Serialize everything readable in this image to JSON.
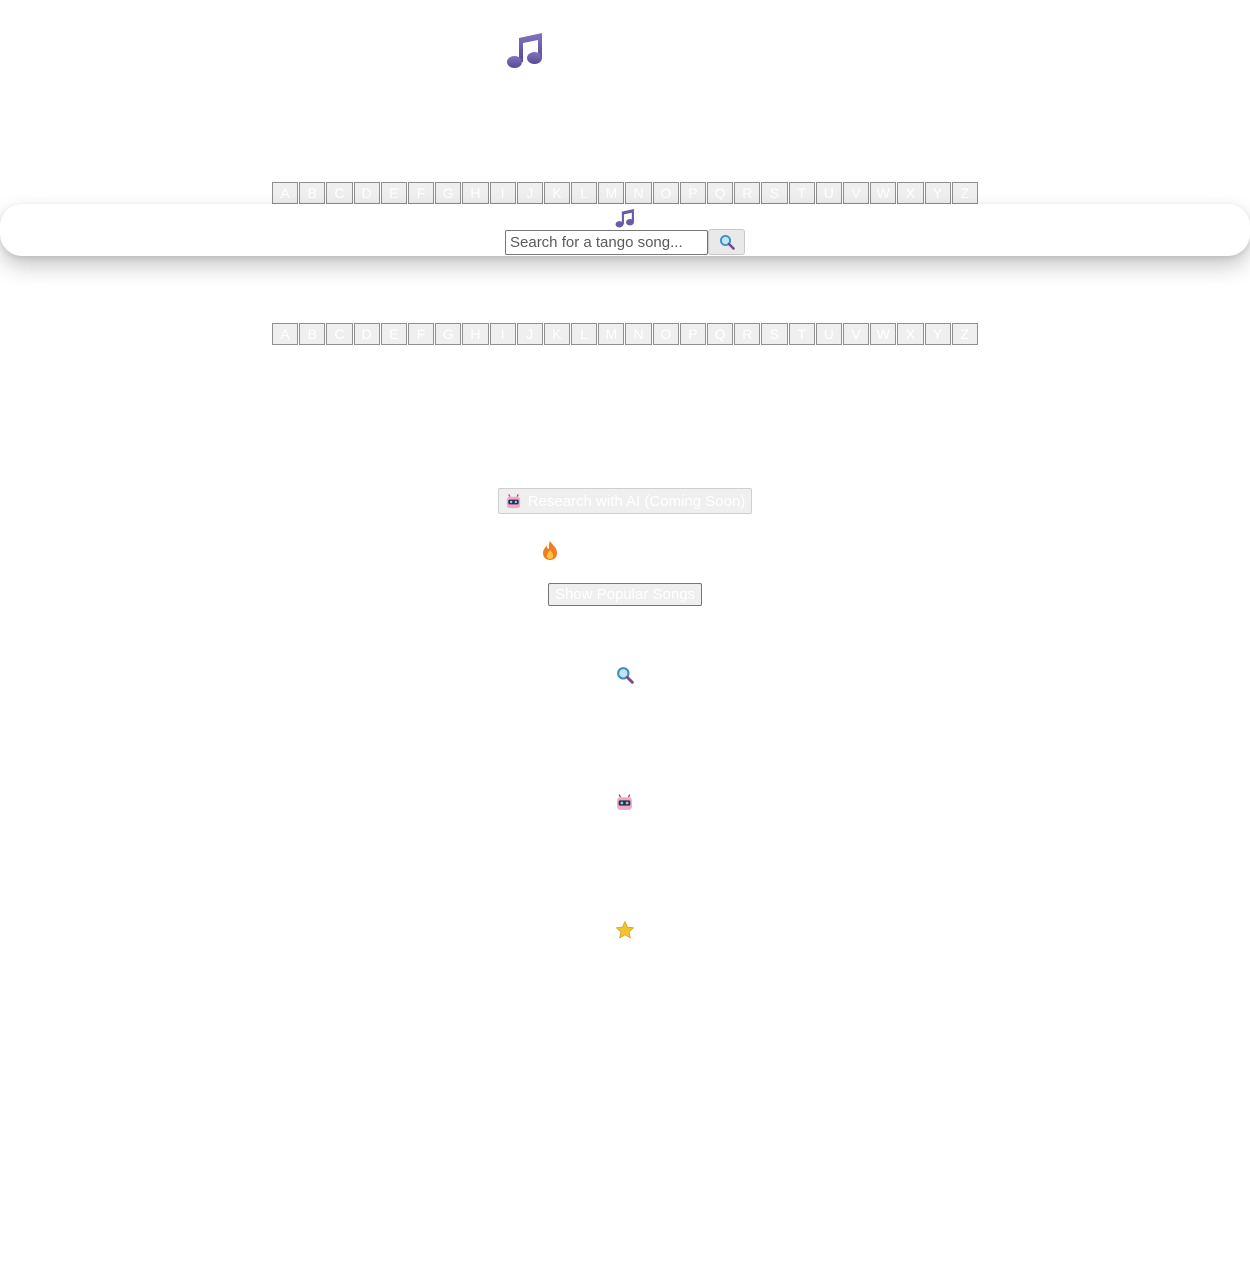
{
  "alphabet": [
    "A",
    "B",
    "C",
    "D",
    "E",
    "F",
    "G",
    "H",
    "I",
    "J",
    "K",
    "L",
    "M",
    "N",
    "O",
    "P",
    "Q",
    "R",
    "S",
    "T",
    "U",
    "V",
    "W",
    "X",
    "Y",
    "Z"
  ],
  "search": {
    "placeholder": "Search for a tango song...",
    "button_icon": "search-icon"
  },
  "ai_button": {
    "label": "Research with AI (Coming Soon)",
    "icon": "robot-icon"
  },
  "popular_button": {
    "label": "Show Popular Songs",
    "icon": "fire-icon"
  },
  "section_icons": [
    "search-icon",
    "robot-icon",
    "star-icon"
  ],
  "colors": {
    "accent": "#6b5aa6",
    "fire": "#f07d20",
    "star": "#f2c230"
  }
}
